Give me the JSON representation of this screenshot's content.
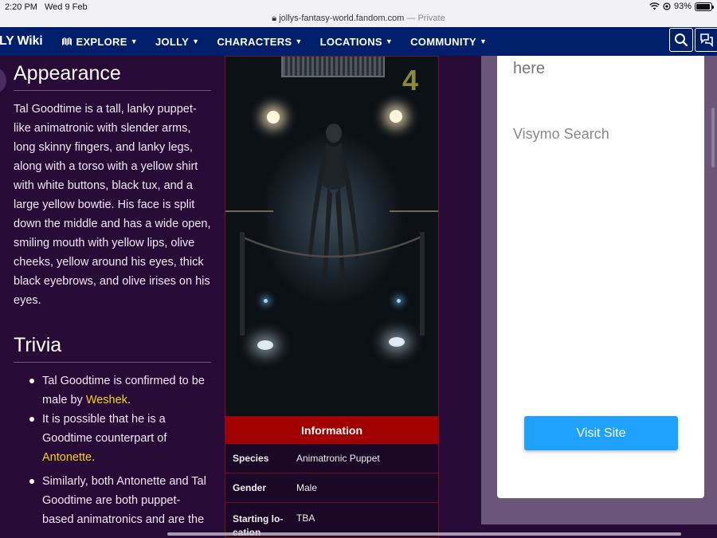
{
  "status_bar": {
    "time": "2:20 PM",
    "date": "Wed 9 Feb",
    "battery": "93%",
    "battery_level": 0.93
  },
  "browser": {
    "url": "jollys-fantasy-world.fandom.com",
    "private_label": "— Private"
  },
  "nav": {
    "brand": "LY Wiki",
    "items": [
      {
        "label": "EXPLORE"
      },
      {
        "label": "JOLLY"
      },
      {
        "label": "CHARACTERS"
      },
      {
        "label": "LOCATIONS"
      },
      {
        "label": "COMMUNITY"
      }
    ]
  },
  "article": {
    "appearance_heading": "Appearance",
    "appearance_text": "Tal Goodtime is a tall, lanky puppet-like animatronic with slender arms, long skinny fingers, and lanky legs, along with a torso with a yellow shirt with white buttons, black tux, and a large yellow bowtie. His face is split down the middle and has a wide open, smiling mouth with yellow lips, olive cheeks, yellow around his eyes, thick black eyebrows, and olive irises on his eyes.",
    "trivia_heading": "Trivia",
    "trivia": [
      {
        "before": "Tal Goodtime is confirmed to be male by ",
        "link": "Weshek",
        "after": "."
      },
      {
        "before": "It is possible that he is a Goodtime counterpart of ",
        "link": "Antonette",
        "after": "."
      }
    ],
    "sub_trivia": "Similarly, both Antonette and Tal Goodtime are both puppet-based animatronics and are the"
  },
  "infobox": {
    "header": "Information",
    "rows": [
      {
        "label": "Species",
        "value": "Animatronic Puppet"
      },
      {
        "label": "Gender",
        "value": "Male"
      },
      {
        "label": "Starting lo-cation",
        "value": "TBA"
      }
    ]
  },
  "ad": {
    "line1": "here",
    "line2": "Visymo Search",
    "button": "Visit Site"
  }
}
